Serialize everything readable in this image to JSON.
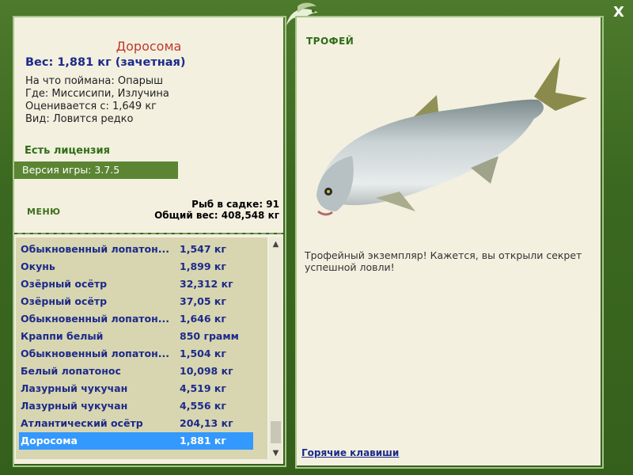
{
  "fish": {
    "name": "Доросома",
    "weight": "Вес: 1,881 кг (зачетная)",
    "bait": "На что поймана: Опарыш",
    "location": "Где: Миссисипи, Излучина",
    "rated": "Оценивается с: 1,649 кг",
    "kind": "Вид: Ловится редко"
  },
  "license": "Есть лицензия",
  "version": "Версия игры: 3.7.5",
  "menu_label": "МЕНЮ",
  "cage": {
    "count": "Рыб в садке: 91",
    "total": "Общий вес: 408,548 кг"
  },
  "list": [
    {
      "name": "Обыкновенный лопатон...",
      "weight": "1,547 кг"
    },
    {
      "name": "Окунь",
      "weight": "1,899 кг"
    },
    {
      "name": "Озёрный осётр",
      "weight": "32,312 кг"
    },
    {
      "name": "Озёрный осётр",
      "weight": "37,05 кг"
    },
    {
      "name": "Обыкновенный лопатон...",
      "weight": "1,646 кг"
    },
    {
      "name": "Краппи белый",
      "weight": "850 грамм"
    },
    {
      "name": "Обыкновенный лопатон...",
      "weight": "1,504 кг"
    },
    {
      "name": "Белый лопатонос",
      "weight": "10,098 кг"
    },
    {
      "name": "Лазурный чукучан",
      "weight": "4,519 кг"
    },
    {
      "name": "Лазурный чукучан",
      "weight": "4,556 кг"
    },
    {
      "name": "Атлантический осётр",
      "weight": "204,13 кг"
    },
    {
      "name": "Доросома",
      "weight": "1,881 кг",
      "selected": true
    }
  ],
  "trophy": {
    "label": "ТРОФЕЙ",
    "text": "Трофейный экземпляр! Кажется, вы открыли секрет успешной ловли!"
  },
  "hotkeys": "Горячие клавиши",
  "close_label": "X",
  "colors": {
    "frame": "#3e6a22",
    "panel": "#f3f0e0",
    "selection": "#3399ff",
    "link": "#1c2a8a",
    "title": "#c0392b"
  }
}
